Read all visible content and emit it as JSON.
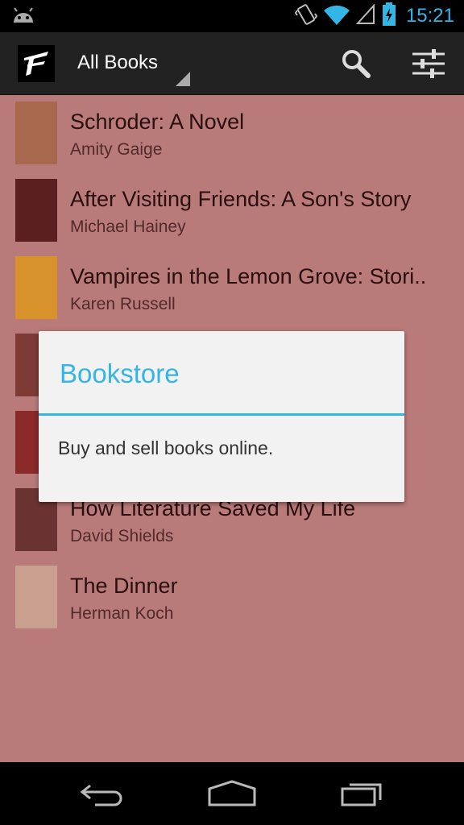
{
  "status_bar": {
    "time": "15:21",
    "icons": [
      "android-debug-icon",
      "vibrate-icon",
      "wifi-icon",
      "signal-icon",
      "battery-charging-icon"
    ]
  },
  "action_bar": {
    "spinner_label": "All Books",
    "actions": [
      "search-icon",
      "settings-sliders-icon"
    ]
  },
  "books": [
    {
      "title": "Schroder: A Novel",
      "author": "Amity Gaige",
      "cover_color": "#a8684e"
    },
    {
      "title": "After Visiting Friends: A Son's Story",
      "author": "Michael Hainey",
      "cover_color": "#5b1f1f"
    },
    {
      "title": "Vampires in the Lemon Grove: Stori..",
      "author": "Karen Russell",
      "cover_color": "#d8922c"
    },
    {
      "title": "",
      "author": "",
      "cover_color": "#7e3b35"
    },
    {
      "title": "",
      "author": "",
      "cover_color": "#8a2a2a"
    },
    {
      "title": "How Literature Saved My Life",
      "author": "David Shields",
      "cover_color": "#6b3232"
    },
    {
      "title": "The Dinner",
      "author": "Herman Koch",
      "cover_color": "#c9a090"
    }
  ],
  "dialog": {
    "title": "Bookstore",
    "message": "Buy and sell books online."
  },
  "colors": {
    "accent": "#33b5e5",
    "list_background": "#b97a7a",
    "action_bar": "#222222"
  }
}
